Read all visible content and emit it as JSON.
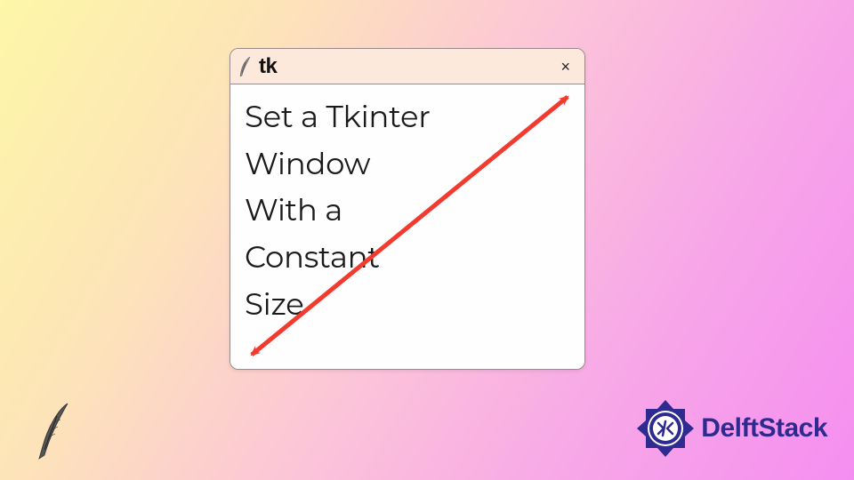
{
  "window": {
    "title": "tk",
    "icon_name": "feather-icon",
    "close_symbol": "×",
    "body_text": "Set a Tkinter\nWindow\nWith a\nConstant\nSize"
  },
  "arrow": {
    "color": "#f23a2f"
  },
  "brand": {
    "name": "DelftStack",
    "color": "#2e2a8f"
  }
}
